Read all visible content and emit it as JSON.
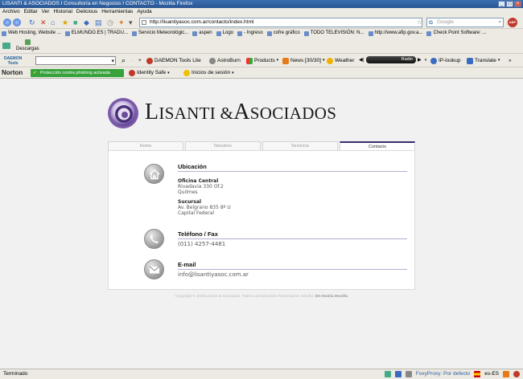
{
  "window": {
    "title": "LISANTI & ASOCIADOS I Consultoría en Negocios I CONTACTO - Mozilla Firefox"
  },
  "menu": [
    "Archivo",
    "Editar",
    "Ver",
    "Historial",
    "Delicious",
    "Herramientas",
    "Ayuda"
  ],
  "nav": {
    "url": "http://lisantiyasoc.com.ar/contacto/index.html",
    "search_placeholder": "Google"
  },
  "bookmarks": [
    "Web Hosting, Website ...",
    "ELMUNDO.ES | TRADU...",
    "Servicio Meteorológic...",
    "aspen",
    "Logo",
    "- Ingreso",
    "cofre gráfico",
    "TODO TELEVISIÓN: N...",
    "http://www.afip.gov.a...",
    "Check Point Software: ..."
  ],
  "downloads_label": "Descargas",
  "daemon": {
    "logo_top": "DAEMON",
    "logo_bottom": "Tools",
    "tools_lite": "DAEMON Tools Lite",
    "astroburn": "AstroBurn",
    "products": "Products",
    "news": "News [30/30]",
    "weather": "Weather",
    "radio": "Radio",
    "ip_lookup": "IP-lookup",
    "translate": "Translate"
  },
  "norton": {
    "brand": "Norton",
    "phishing": "Protección contra phishing activada",
    "identity": "Identity Safe",
    "logins": "Inicios de sesión"
  },
  "site": {
    "logo_first_initial": "L",
    "logo_first_rest": "ISANTI",
    "logo_amp": "&",
    "logo_second_initial": "A",
    "logo_second_rest": "SOCIADOS",
    "tabs": [
      {
        "label": "Home",
        "active": false
      },
      {
        "label": "Nosotros",
        "active": false
      },
      {
        "label": "Servicios",
        "active": false
      },
      {
        "label": "Contacto",
        "active": true
      }
    ],
    "ubicacion": {
      "title": "Ubicación",
      "office_label": "Oficina Central",
      "office_lines": [
        "Rivadavia 330 Of.2",
        "Quilmes"
      ],
      "branch_label": "Sucursal",
      "branch_lines": [
        "Av. Belgrano 835 8º U",
        "Capital Federal"
      ]
    },
    "telefono": {
      "title": "Teléfono / Fax",
      "value": "(011) 4257-4481"
    },
    "email": {
      "title": "E-mail",
      "value": "info@lisantiyasoc.com.ar"
    },
    "copyright_text": "Copyright © 2009 Lisanti & Asociados. Todos Los Derechos Reservados. Diseño:",
    "designer": "DG Noelia Movilla"
  },
  "status": {
    "text": "Terminado",
    "foxyproxy": "FoxyProxy: Por defecto",
    "locale": "es-ES"
  },
  "colors": {
    "accent_purple": "#4a3a7a",
    "firefox_titlebar": "#2a5592",
    "norton_green": "#37a23b"
  }
}
